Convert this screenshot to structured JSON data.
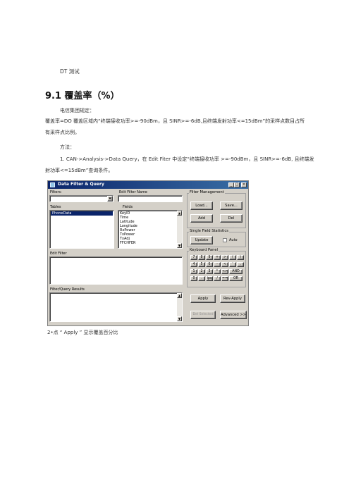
{
  "document": {
    "header": "DT 测试",
    "heading": "9.1 覆盖率（%）",
    "lines": [
      "电信集团规定：",
      "覆盖率=DO 覆盖区域内“终端接收功率>=-90dBm，且 SINR>=-6dB,且终端发射功率<=15dBm”的采样点数目占所",
      "有采样点比例。",
      "方法：",
      "1.   CAN->Analysis->Data Query，在 Edit Fiter 中设定“终端接收功率 >=-90dBm，且 SINR>=-6dB, 且终端发",
      "射功率<=15dBm”查询条件。",
      "2•点 “ Apply ” 显示覆盖百分比"
    ]
  },
  "dialog": {
    "title": "Data Filter & Query",
    "window_buttons": {
      "minimize": "_",
      "maximize": "□",
      "close": "×"
    },
    "filters_label": "Filters:",
    "edit_filter_name_label": "Edit Filter Name",
    "tables_label": "Tables",
    "fields_label": "Fields",
    "tables": [
      "PhoneData"
    ],
    "fields": [
      "KeyID",
      "Time",
      "Latitude",
      "Longitude",
      "RxPower",
      "TxPower",
      "TxAdj",
      "FFCHFER"
    ],
    "edit_filter_label": "Edit Filter",
    "results_label": "Filter/Query Results",
    "filter_management": {
      "title": "Filter Management",
      "load": "Load...",
      "save": "Save...",
      "add": "Add",
      "del": "Del"
    },
    "single_field": {
      "title": "Single Field Statistics",
      "update": "Update",
      "auto": "Auto"
    },
    "keyboard": {
      "title": "Keyboard Panel",
      "rows": [
        [
          "7",
          "8",
          "9",
          "+",
          ">",
          "(",
          ")"
        ],
        [
          "4",
          "5",
          "6",
          "-",
          "<",
          "'",
          ","
        ],
        [
          "1",
          "2",
          "3",
          "*",
          "<>",
          "AND"
        ],
        [
          "0",
          ".",
          "ipc",
          "/",
          "==",
          "OR"
        ]
      ]
    },
    "apply": "Apply",
    "rev_apply": "Rev-Apply",
    "del_selected": "Del Selected",
    "advanced": "Advanced >>"
  },
  "colors": {
    "titlebar": "#0a246a",
    "dialog_bg": "#d4d0c8",
    "selection": "#0a246a"
  }
}
